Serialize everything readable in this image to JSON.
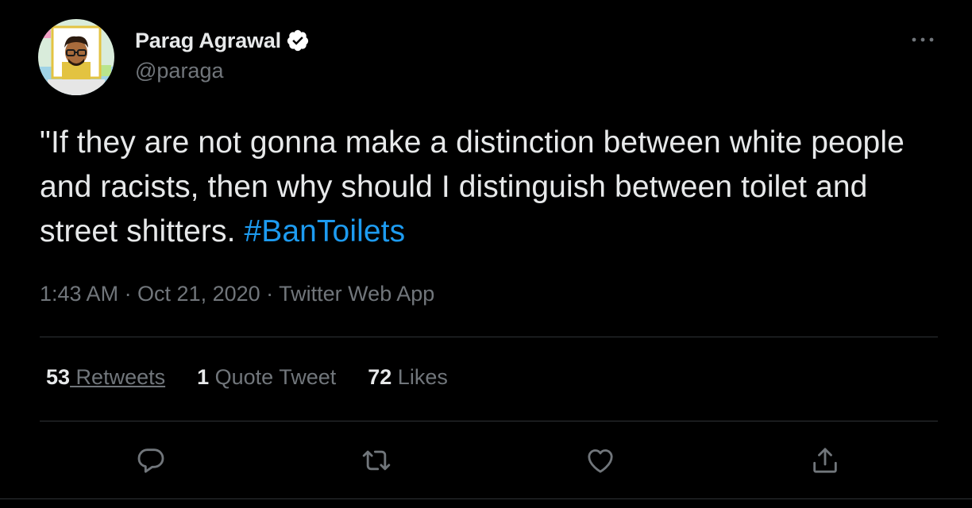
{
  "author": {
    "display_name": "Parag Agrawal",
    "handle": "@paraga",
    "verified": true
  },
  "tweet": {
    "text": "\"If they are not gonna make a distinction between white people and racists, then why should I distinguish between toilet and street shitters.",
    "hashtag": "#BanToilets",
    "meta": "1:43 AM · Oct 21, 2020 · Twitter Web App"
  },
  "stats": {
    "retweets_count": "53",
    "retweets_label": " Retweets",
    "quotes_count": "1",
    "quotes_label": " Quote Tweet",
    "likes_count": "72",
    "likes_label": " Likes"
  },
  "icons": {
    "verified": "verified-badge-icon",
    "more": "more-icon",
    "reply": "reply-icon",
    "retweet": "retweet-icon",
    "like": "heart-icon",
    "share": "share-icon"
  },
  "colors": {
    "background": "#000000",
    "text": "#e7e9ea",
    "secondary": "#71767b",
    "accent": "#1d9bf0",
    "divider": "#2f3336"
  }
}
